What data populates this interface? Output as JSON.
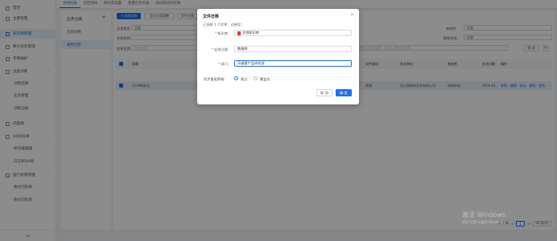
{
  "sidebar": {
    "items": [
      {
        "label": "首页"
      },
      {
        "label": "主题管理"
      },
      {
        "label": "知识库管理"
      },
      {
        "label": "数仓任务管理"
      },
      {
        "label": "字典维护"
      },
      {
        "label": "主题训练"
      },
      {
        "label": "训练结果"
      },
      {
        "label": "任务管理"
      },
      {
        "label": "训练记录"
      },
      {
        "label": "问题库"
      },
      {
        "label": "QA问答库"
      },
      {
        "label": "标问编辑器"
      },
      {
        "label": "日志标QA库"
      },
      {
        "label": "运行权限管理"
      },
      {
        "label": "数仓问答库"
      },
      {
        "label": "数仓问答库"
      }
    ],
    "collapse_glyph": "≡"
  },
  "tabs": [
    "文档列表",
    "召回测试",
    "知识库设置",
    "批量任务列表",
    "知识库访问权限"
  ],
  "category": {
    "title": "业务分类",
    "add_glyph": "+",
    "items": [
      "全部文档",
      "通用文档"
    ]
  },
  "toolbar": {
    "add_label": "+ 添加文档",
    "batch_label": "业务分类调整",
    "move_label": "文件迁移"
  },
  "filters": {
    "business_type_label": "业务类型",
    "business_type_value": "全部",
    "doc_name_label": "文档名称",
    "doc_name_placeholder": "",
    "change_date_label": "变更日期",
    "change_date_placeholder": "开始日期",
    "valid_label": "有效性",
    "valid_value": "全部",
    "parse_label": "解析状态",
    "parse_value": "全部",
    "keyword_placeholder": "请输入文档标题、文号、发布单位等",
    "search_label": "筛 选",
    "refresh_glyph": "⟳"
  },
  "table": {
    "columns": [
      "标题",
      "文档类型",
      "文件级别",
      "发文单位",
      "有效性",
      "发文日期",
      "操作"
    ],
    "row": {
      "title": "0129新标兵",
      "doc_type": "",
      "level": "普通",
      "unit": "浙江奥钢有开发有限公司",
      "valid": "同期有效",
      "date": "2026-01",
      "actions": "查看 · 编辑 · 移出 · 删除 · 更多"
    }
  },
  "pager": {
    "total": "共 1 条",
    "prev": "<",
    "page": "1",
    "next": ">",
    "size": "20 条/页"
  },
  "modal": {
    "title": "文件迁移",
    "close_glyph": "×",
    "info": "已选择 1 个文件，迁移至：",
    "kb_label": "知识库",
    "kb_value": "文档知识库",
    "cat_label": "业务分类",
    "cat_value": "数据库",
    "dept_label": "部门",
    "dept_value": "乐器客户品研发部",
    "strategy_label": "同步重复策略：",
    "opt_skip": "跳过",
    "opt_overwrite": "覆盖名",
    "cancel_label": "取 消",
    "ok_label": "确 定",
    "required_mark": "*"
  },
  "watermark": {
    "line1": "激活 Windows",
    "line2": "转到\"设置\"以激活 Windows。"
  }
}
